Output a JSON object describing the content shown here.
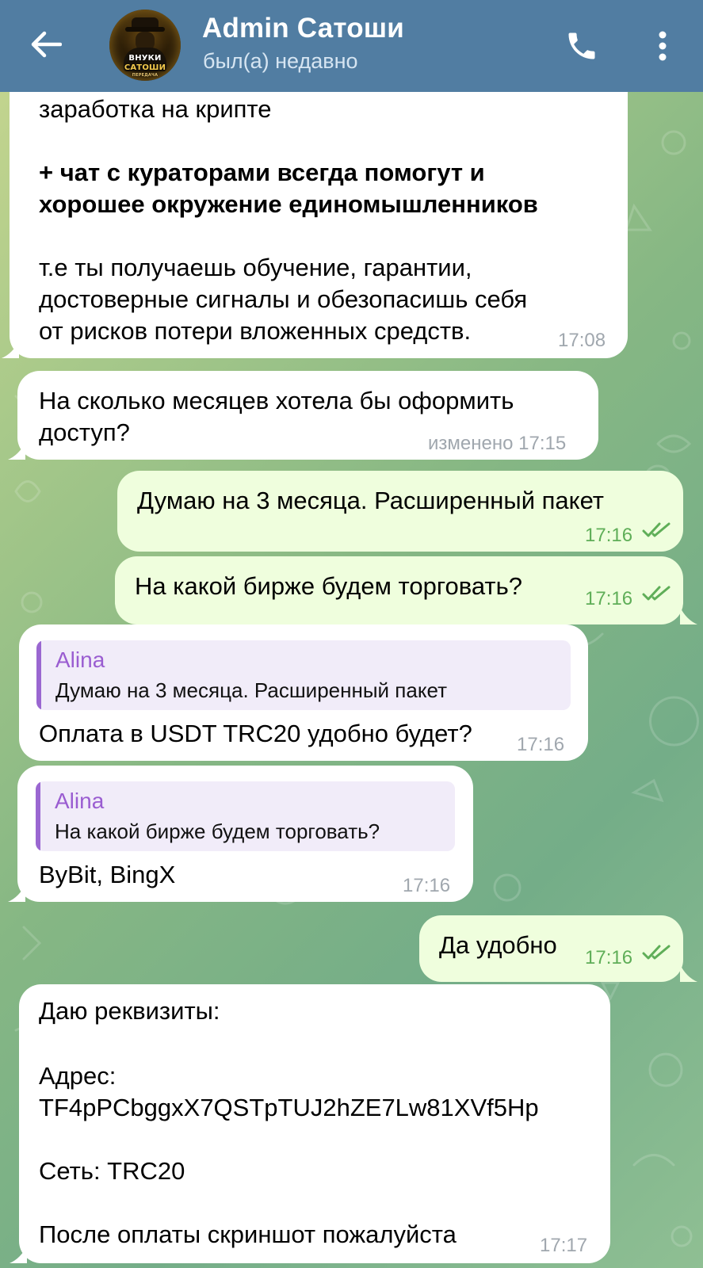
{
  "header": {
    "title": "Admin Сатоши",
    "status": "был(а) недавно",
    "avatar_text": [
      "ВНУКИ",
      "САТОШИ",
      "ПЕРЕДАЧА"
    ]
  },
  "messages": [
    {
      "id": "m1",
      "direction": "incoming",
      "lines": [
        "заработка на крипте",
        "",
        "+ чат с кураторами всегда помогут и",
        "хорошее окружение единомышленников",
        "",
        "т.е ты получаешь обучение, гарантии,",
        "достоверные сигналы и обезопасишь себя",
        "от рисков потери вложенных средств."
      ],
      "time": "17:08"
    },
    {
      "id": "m2",
      "direction": "incoming",
      "lines": [
        "На сколько месяцев хотела бы оформить",
        "доступ?"
      ],
      "time": "изменено 17:15"
    },
    {
      "id": "m3",
      "direction": "outgoing",
      "lines": [
        "Думаю на 3 месяца. Расширенный пакет"
      ],
      "time": "17:16",
      "read": true
    },
    {
      "id": "m4",
      "direction": "outgoing",
      "lines": [
        "На какой бирже будем торговать?"
      ],
      "time": "17:16",
      "read": true
    },
    {
      "id": "m5",
      "direction": "incoming",
      "reply": {
        "name": "Alina",
        "quote": "Думаю на 3 месяца. Расширенный пакет"
      },
      "lines": [
        "Оплата в USDT TRC20 удобно будет?"
      ],
      "time": "17:16"
    },
    {
      "id": "m6",
      "direction": "incoming",
      "reply": {
        "name": "Alina",
        "quote": "На какой бирже будем торговать?"
      },
      "lines": [
        "ByBit, BingX"
      ],
      "time": "17:16"
    },
    {
      "id": "m7",
      "direction": "outgoing",
      "lines": [
        "Да удобно"
      ],
      "time": "17:16",
      "read": true
    },
    {
      "id": "m8",
      "direction": "incoming",
      "lines": [
        "Даю реквизиты:",
        "",
        "Адрес:",
        "TF4pPCbggxX7QSTpTUJ2hZE7Lw81XVf5Hp",
        "",
        "Сеть: TRC20",
        "",
        "После оплаты скриншот пожалуйста"
      ],
      "time": "17:17"
    }
  ],
  "colors": {
    "header_bg": "#517da2",
    "incoming_bubble": "#ffffff",
    "outgoing_bubble": "#effedd",
    "read_ticks": "#5fae58",
    "reply_accent": "#9a67d1"
  }
}
